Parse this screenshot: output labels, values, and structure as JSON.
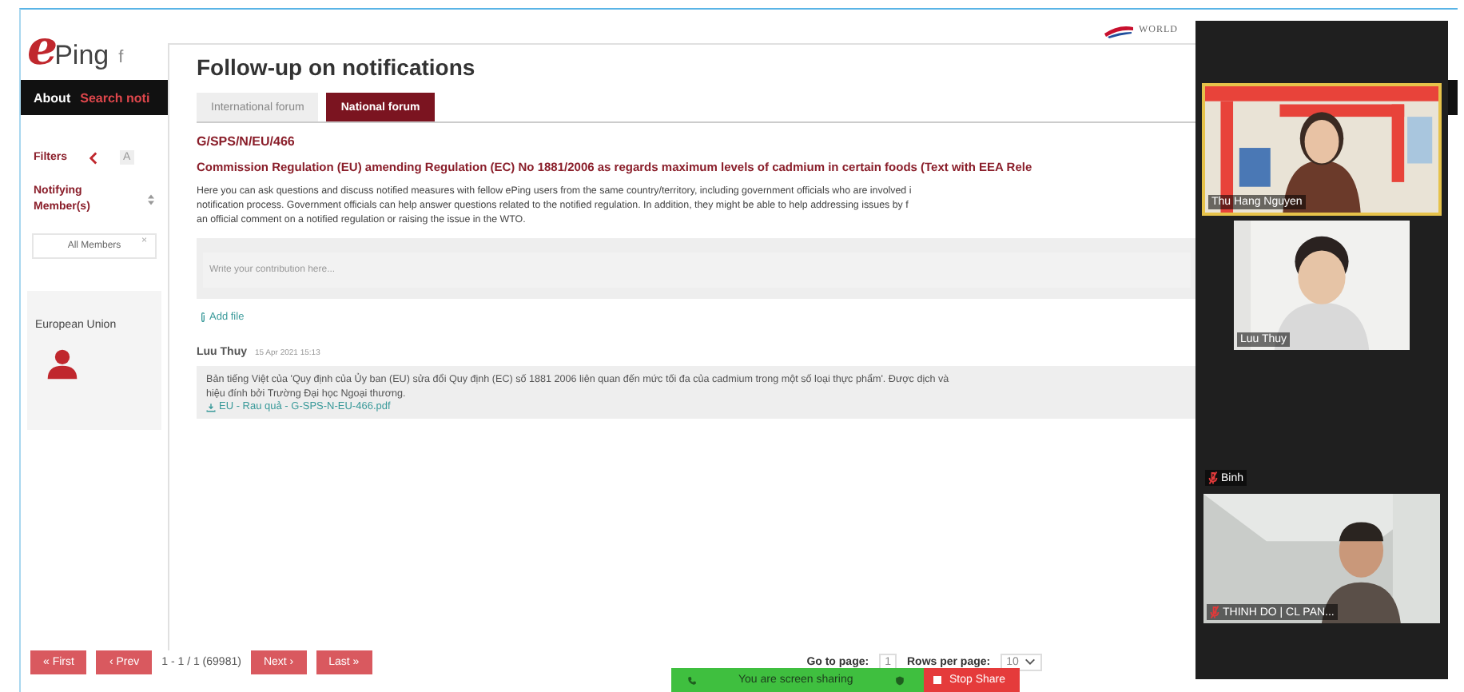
{
  "app": {
    "logo": {
      "mark": "e",
      "text": "Ping"
    },
    "header_cut": "f",
    "org_logo": "WORLD",
    "nav": [
      "About",
      "Search noti"
    ],
    "filters": {
      "label": "Filters",
      "tab_cut": "A",
      "member_label": "Notifying Member(s)",
      "member_select": "All Members",
      "clear": "×",
      "member": "European Union"
    }
  },
  "modal": {
    "title": "Follow-up on notifications",
    "tabs": [
      {
        "label": "International forum",
        "selected": false
      },
      {
        "label": "National forum",
        "selected": true
      }
    ],
    "code": "G/SPS/N/EU/466",
    "heading": "Commission Regulation (EU) amending Regulation (EC) No 1881/2006 as regards maximum levels of cadmium in certain foods (Text with EEA Rele",
    "intro": "Here you can ask questions and discuss notified measures with fellow ePing users from the same country/territory, including government officials who are involved i\nnotification process. Government officials can help answer questions related to the notified regulation. In addition, they might be able to help addressing issues by f\nan official comment on a notified regulation or raising the issue in the WTO.",
    "contribution": {
      "placeholder": "Write your contribution here..."
    },
    "add_file": "Add file",
    "comments": [
      {
        "author": "Luu Thuy",
        "date": "15 Apr 2021 15:13",
        "body": "Bản tiếng Việt của 'Quy định của Ủy ban (EU) sửa đổi Quy định (EC) số 1881 2006 liên quan đến mức tối đa của cadmium trong một số loại thực phẩm'. Được dịch và\nhiệu đính bởi Trường Đại học Ngoại thương.",
        "attachment": "EU - Rau quả - G-SPS-N-EU-466.pdf"
      }
    ]
  },
  "pagination": {
    "buttons": [
      "« First",
      "‹ Prev"
    ],
    "range": "1 - 1 / 1 (69981)",
    "buttons_after": [
      "Next ›",
      "Last »"
    ],
    "go_label": "Go to page:",
    "go_value": "1",
    "rows_label": "Rows per page:",
    "rows_value": "10"
  },
  "meeting": {
    "participants": [
      {
        "name": "Thu Hang Nguyen",
        "kind": "video",
        "speaking": true,
        "muted": false
      },
      {
        "name": "Luu Thuy",
        "kind": "video",
        "speaking": false,
        "muted": false
      },
      {
        "name": "Binh",
        "kind": "name",
        "speaking": false,
        "muted": true
      },
      {
        "name": "THINH DO | CL PAN...",
        "kind": "video",
        "speaking": false,
        "muted": true
      }
    ],
    "share_status": "You are screen sharing",
    "stop_share": "Stop Share"
  }
}
